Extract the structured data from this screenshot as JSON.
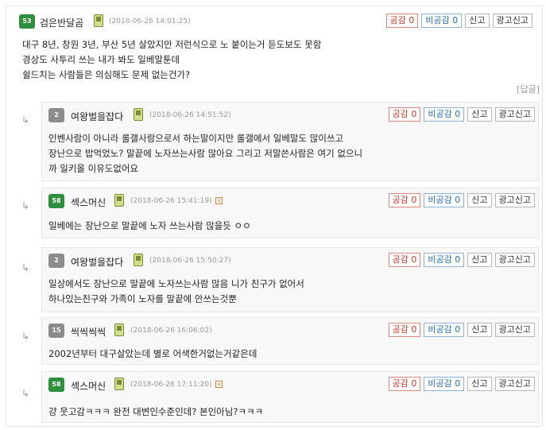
{
  "labels": {
    "like": "공감",
    "dislike": "비공감",
    "report": "신고",
    "ad_report": "광고신고",
    "reply": "[답글]"
  },
  "comments": [
    {
      "level": "53",
      "nick": "검은반달곰",
      "date": "(2018-06-26 14:01:25)",
      "likes": "0",
      "dislikes": "0",
      "lines": [
        "대구 8년, 창원 3년, 부산 5년 살았지만 저런식으로 노 붙이는거 듣도보도 못함",
        "경상도 사투리 쓰는 내가 봐도 일베말툰데",
        "쉴드치는 사람들은 의심해도 문제 없는건가?"
      ]
    },
    {
      "level": "2",
      "nick": "여왕벌을잡다",
      "date": "(2018-06-26 14:51:52)",
      "likes": "0",
      "dislikes": "0",
      "lines": [
        "인벤사람이 아니라 롤갤사람으로서 하는말이지만 롤갤에서 일베말도 많이쓰고",
        "장난으로 밥먹었노? 말끝에 노자쓰는사람 많아요 그리고 저말쓴사람은 여기 없으니",
        "까 일키올 이유도없어요"
      ]
    },
    {
      "level": "58",
      "nick": "섹스머신",
      "date": "(2018-06-26 15:41:19)",
      "likes": "0",
      "dislikes": "0",
      "lines": [
        "일베에는 장난으로 말끝에 노자 쓰는사람 많을듯 ㅇㅇ"
      ]
    },
    {
      "level": "2",
      "nick": "여왕벌을잡다",
      "date": "(2018-06-26 15:50:27)",
      "likes": "0",
      "dislikes": "0",
      "lines": [
        "일상에서도 장난으로 말끝에 노자쓰는사람 많음 니가 친구가 없어서",
        "하나있는친구와 가족이 노자를 말끝에 안쓰는것뿐"
      ]
    },
    {
      "level": "15",
      "nick": "씩씩씩씩",
      "date": "(2018-06-26 16:06:02)",
      "likes": "0",
      "dislikes": "0",
      "lines": [
        "2002년부터 대구살았는데 별로 어색한거없는거같은데"
      ]
    },
    {
      "level": "58",
      "nick": "섹스머신",
      "date": "(2018-06-26 17:11:20)",
      "likes": "0",
      "dislikes": "0",
      "lines": [
        "걍 웃고감ㅋㅋㅋ 완전 대변인수준인데? 본인아님?ㅋㅋㅋ"
      ]
    }
  ],
  "icons": {
    "level_badge_green": "#2f8f3e",
    "level_badge_grey": "#8c8c8c",
    "mobile": "phone-icon",
    "x": "x-icon",
    "reply_arrow": "↳"
  }
}
